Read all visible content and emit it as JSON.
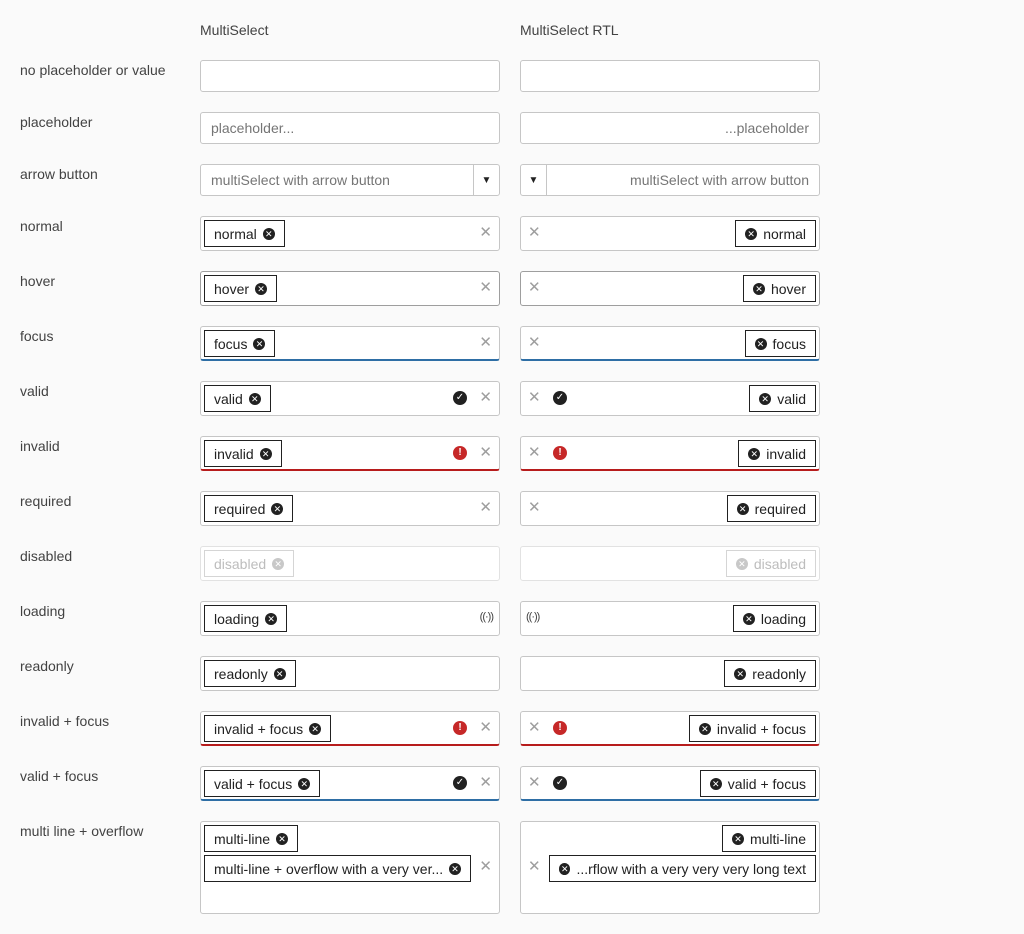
{
  "columns": {
    "ltr": "MultiSelect",
    "rtl": "MultiSelect RTL"
  },
  "rows": {
    "empty": "no placeholder or value",
    "placeholder": "placeholder",
    "arrow": "arrow button",
    "normal": "normal",
    "hover": "hover",
    "focus": "focus",
    "valid": "valid",
    "invalid": "invalid",
    "required": "required",
    "disabled": "disabled",
    "loading": "loading",
    "readonly": "readonly",
    "invalid_focus": "invalid + focus",
    "valid_focus": "valid + focus",
    "multiline": "multi line + overflow"
  },
  "placeholder": {
    "ltr": "placeholder...",
    "rtl": "...placeholder"
  },
  "arrow_text": "multiSelect with arrow button",
  "chips": {
    "normal": "normal",
    "hover": "hover",
    "focus": "focus",
    "valid": "valid",
    "invalid": "invalid",
    "required": "required",
    "disabled": "disabled",
    "loading": "loading",
    "readonly": "readonly",
    "invalid_focus": "invalid + focus",
    "valid_focus": "valid + focus",
    "multiline_1": "multi-line",
    "multiline_2_ltr": "multi-line + overflow with a very ver...",
    "multiline_2_rtl": "...rflow with a very very very long text"
  },
  "icons": {
    "clear": "close-icon",
    "remove": "remove-chip-icon",
    "valid": "check-circle-icon",
    "invalid": "exclamation-circle-icon",
    "loading": "loading-icon",
    "arrow": "caret-down-icon"
  },
  "colors": {
    "focus": "#2e6ea5",
    "invalid": "#b71c1c",
    "invalid_icon": "#c62828"
  }
}
